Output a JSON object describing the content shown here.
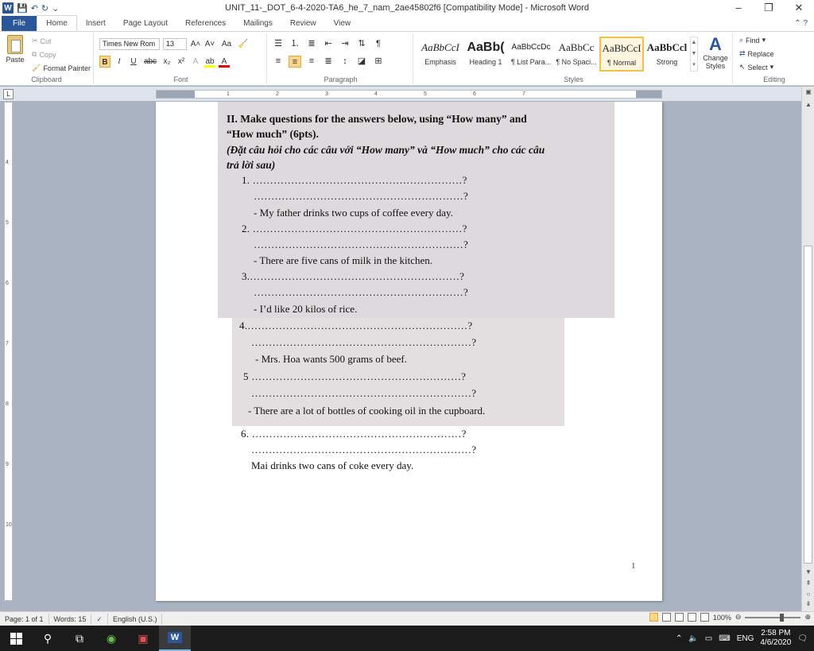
{
  "window": {
    "title": "UNIT_11-_DOT_6-4-2020-TA6_he_7_nam_2ae45802f6 [Compatibility Mode] - Microsoft Word",
    "minimize": "–",
    "restore": "❐",
    "close": "✕"
  },
  "ribbon_tabs": [
    "File",
    "Home",
    "Insert",
    "Page Layout",
    "References",
    "Mailings",
    "Review",
    "View"
  ],
  "clipboard": {
    "paste": "Paste",
    "cut": "Cut",
    "copy": "Copy",
    "format_painter": "Format Painter",
    "label": "Clipboard"
  },
  "font": {
    "name": "Times New Rom",
    "size": "13",
    "grow": "A˄",
    "shrink": "A˅",
    "change_case": "Aa",
    "clear": "🧹",
    "bold": "B",
    "italic": "I",
    "underline": "U",
    "strike": "abc",
    "subscript": "x₂",
    "superscript": "x²",
    "label": "Font"
  },
  "paragraph": {
    "label": "Paragraph"
  },
  "styles": {
    "items": [
      {
        "sample": "AaBbCcI",
        "name": "Emphasis"
      },
      {
        "sample": "AaBb(",
        "name": "Heading 1"
      },
      {
        "sample": "AaBbCcDc",
        "name": "¶ List Para..."
      },
      {
        "sample": "AaBbCc",
        "name": "¶ No Spaci..."
      },
      {
        "sample": "AaBbCcI",
        "name": "¶ Normal"
      },
      {
        "sample": "AaBbCcl",
        "name": "Strong"
      }
    ],
    "change_styles": "Change Styles",
    "label": "Styles"
  },
  "editing": {
    "find": "Find",
    "replace": "Replace",
    "select": "Select",
    "label": "Editing"
  },
  "document": {
    "heading_line1": "II. Make questions for the answers below, using “How many” and",
    "heading_line2": "“How much” (6pts).",
    "viet_line1": "(Đặt câu hỏi cho các câu với “How many” và “How much” cho các câu",
    "viet_line2": "trả lời sau)",
    "questions": [
      {
        "num": "1.",
        "answer": "- My father drinks two cups of coffee every day."
      },
      {
        "num": "2.",
        "answer": "- There are five cans of milk in the kitchen."
      },
      {
        "num": "3.",
        "answer": "- I’d like 20 kilos of rice."
      },
      {
        "num": "4.",
        "answer": "- Mrs. Hoa wants 500 grams of beef."
      },
      {
        "num": "5",
        "answer": "- There are a lot of bottles of cooking oil in the cupboard."
      },
      {
        "num": "6.",
        "answer": "Mai drinks two cans of coke every day."
      }
    ],
    "page_number": "1"
  },
  "status": {
    "page": "Page: 1 of 1",
    "words": "Words: 15",
    "language": "English (U.S.)",
    "zoom": "100%"
  },
  "taskbar": {
    "lang": "ENG",
    "time": "2:58 PM",
    "date": "4/6/2020"
  }
}
